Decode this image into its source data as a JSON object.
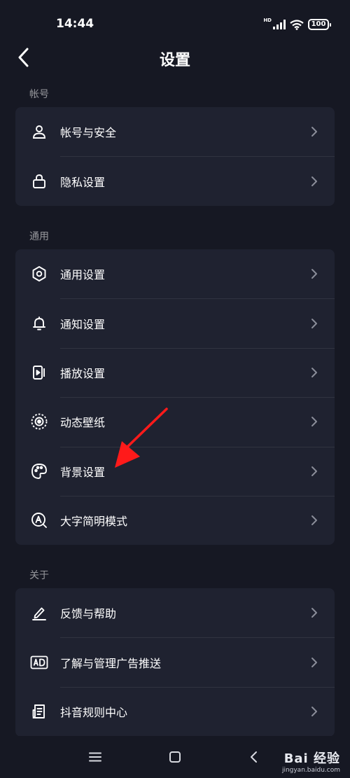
{
  "status_bar": {
    "time": "14:44",
    "battery": "100",
    "network": "HD"
  },
  "header": {
    "title": "设置"
  },
  "sections": [
    {
      "label": "帐号",
      "items": [
        {
          "label": "帐号与安全",
          "icon": "user-icon"
        },
        {
          "label": "隐私设置",
          "icon": "lock-icon"
        }
      ]
    },
    {
      "label": "通用",
      "items": [
        {
          "label": "通用设置",
          "icon": "gear-icon"
        },
        {
          "label": "通知设置",
          "icon": "bell-icon"
        },
        {
          "label": "播放设置",
          "icon": "play-icon"
        },
        {
          "label": "动态壁纸",
          "icon": "live-wallpaper-icon"
        },
        {
          "label": "背景设置",
          "icon": "palette-icon"
        },
        {
          "label": "大字简明模式",
          "icon": "large-text-icon"
        }
      ]
    },
    {
      "label": "关于",
      "items": [
        {
          "label": "反馈与帮助",
          "icon": "pen-icon"
        },
        {
          "label": "了解与管理广告推送",
          "icon": "ad-icon"
        },
        {
          "label": "抖音规则中心",
          "icon": "document-icon"
        }
      ]
    }
  ],
  "watermark": {
    "brand": "Bai 经验",
    "url": "jingyan.baidu.com"
  },
  "colors": {
    "background": "#161823",
    "card": "#1f2230",
    "annotation_arrow": "#ff1a1a"
  }
}
